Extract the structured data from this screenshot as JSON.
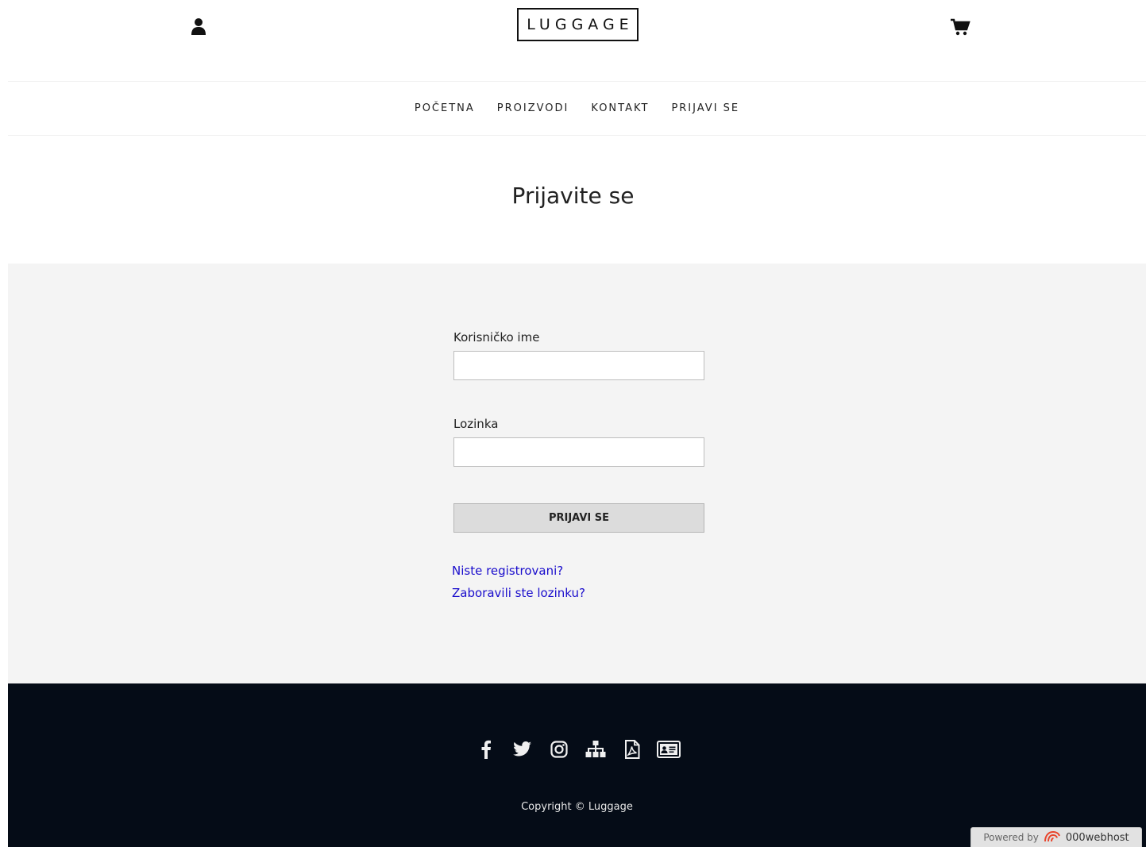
{
  "header": {
    "logo_text": "LUGGAGE",
    "user_icon": "user-icon",
    "cart_icon": "cart-icon"
  },
  "nav": {
    "items": [
      {
        "label": "POČETNA"
      },
      {
        "label": "PROIZVODI"
      },
      {
        "label": "KONTAKT"
      },
      {
        "label": "PRIJAVI SE"
      }
    ]
  },
  "page": {
    "title": "Prijavite se"
  },
  "login_form": {
    "username_label": "Korisničko ime",
    "username_value": "",
    "password_label": "Lozinka",
    "password_value": "",
    "submit_label": "PRIJAVI SE",
    "register_link": "Niste registrovani?",
    "forgot_link": "Zaboravili ste lozinku?",
    "link_color": "#1a0dcc"
  },
  "footer": {
    "social_icons": [
      "facebook-icon",
      "twitter-icon",
      "instagram-icon",
      "sitemap-icon",
      "pdf-icon",
      "id-card-icon"
    ],
    "copyright": "Copyright © Luggage",
    "background_color": "#050c17"
  },
  "badge": {
    "powered_text": "Powered by",
    "brand_text": "000webhost"
  }
}
